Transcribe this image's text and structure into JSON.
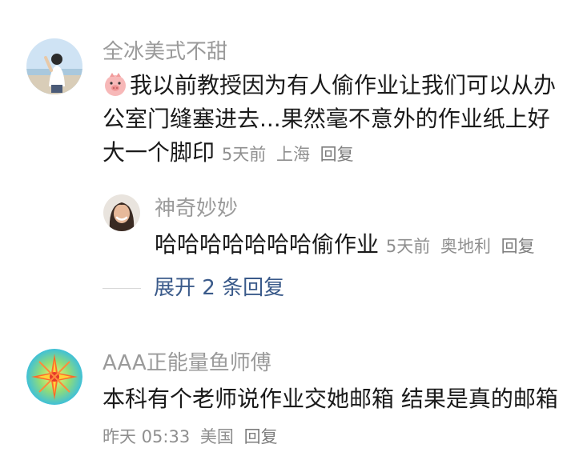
{
  "comments": [
    {
      "username": "全冰美式不甜",
      "avatar_icon": "person-photo-avatar",
      "emoji_icon": "pig-face-emoji-icon",
      "text_lines": [
        "我以前教授因为有人偷作业让我们可以从办",
        "公室门缝塞进去...果然毫不意外的作业纸上好",
        "大一个脚印"
      ],
      "time": "5天前",
      "location": "上海",
      "reply_label": "回复",
      "replies": [
        {
          "username": "神奇妙妙",
          "avatar_icon": "smiling-woman-avatar",
          "text": "哈哈哈哈哈哈哈偷作业",
          "time": "5天前",
          "location": "奥地利",
          "reply_label": "回复"
        }
      ],
      "expand_label": "展开 2 条回复"
    },
    {
      "username": "AAA正能量鱼师傅",
      "avatar_icon": "sunburst-logo-avatar",
      "text_lines": [
        "本科有个老师说作业交她邮箱 结果是真的邮箱"
      ],
      "time": "昨天 05:33",
      "location": "美国",
      "reply_label": "回复"
    }
  ],
  "colors": {
    "username": "#9a9a9a",
    "text": "#1a1a1a",
    "meta": "#8f8f8f",
    "expand_link": "#3a5a8a"
  }
}
